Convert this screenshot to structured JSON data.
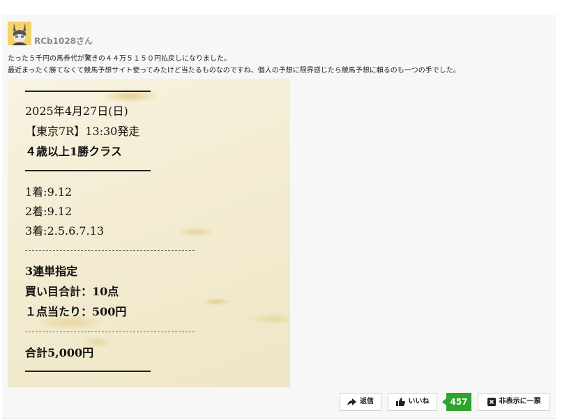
{
  "comment": {
    "username": "RCb1028さん",
    "text_lines": [
      "たった５千円の馬券代が驚きの４４万５１５０円払戻しになりました。",
      "最近まったく勝てなくて競馬予想サイト使ってみたけど当たるものなのですね、個人の予想に限界感じたら競馬予想に頼るのも一つの手でした。"
    ]
  },
  "ticket": {
    "date": "2025年4月27日(日)",
    "race": "【東京7R】13:30発走",
    "class": "４歳以上1勝クラス",
    "first": "1着:9.12",
    "second": "2着:9.12",
    "third": "3着:2.5.6.7.13",
    "bet_type": "3連単指定",
    "points": "買い目合計：10点",
    "per_point": "１点当たり：500円",
    "total": "合計5,000円"
  },
  "actions": {
    "reply_label": "返信",
    "like_label": "いいね",
    "like_count": "457",
    "hide_label": "非表示に一票"
  },
  "colors": {
    "like_count_bg": "#2ea32e",
    "username": "#8a8a8a"
  }
}
